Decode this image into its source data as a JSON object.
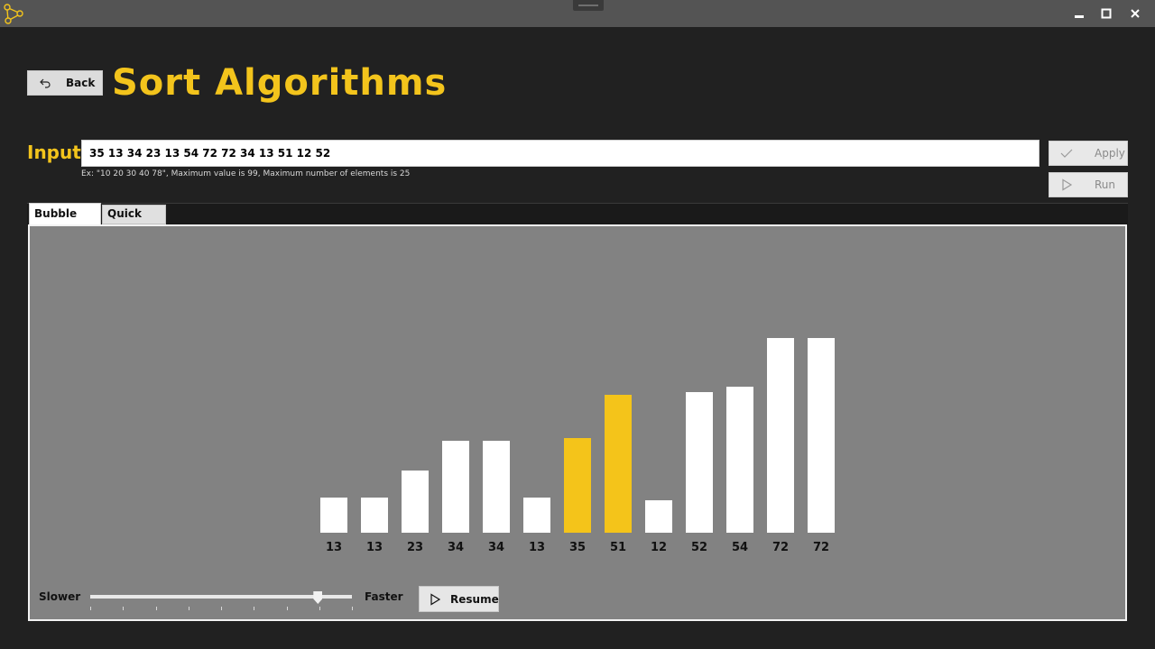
{
  "window": {
    "icons": {
      "app": "molecule-icon",
      "minimize": "minimize-icon",
      "maximize": "maximize-icon",
      "close": "close-icon"
    }
  },
  "header": {
    "back_label": "Back",
    "back_icon": "undo-arrow-icon",
    "title": "Sort Algorithms"
  },
  "input": {
    "label": "Input",
    "value": "35 13 34 23 13 54 72 72 34 13 51 12 52",
    "hint": "Ex: \"10 20 30 40 78\", Maximum value is 99, Maximum number of elements is 25",
    "apply_label": "Apply",
    "apply_icon": "checkmark-icon",
    "run_label": "Run",
    "run_icon": "play-icon"
  },
  "tabs": [
    {
      "label": "Bubble Sort",
      "active": true
    },
    {
      "label": "Quick Sort",
      "active": false
    }
  ],
  "controls": {
    "slower_label": "Slower",
    "faster_label": "Faster",
    "speed_fraction": 0.87,
    "tick_count": 9,
    "resume_label": "Resume",
    "resume_icon": "play-icon"
  },
  "chart_data": {
    "type": "bar",
    "categories": [
      "13",
      "13",
      "23",
      "34",
      "34",
      "13",
      "35",
      "51",
      "12",
      "52",
      "54",
      "72",
      "72"
    ],
    "values": [
      13,
      13,
      23,
      34,
      34,
      13,
      35,
      51,
      12,
      52,
      54,
      72,
      72
    ],
    "highlighted_indices": [
      6,
      7
    ],
    "bar_color": "#ffffff",
    "highlight_color": "#f4c41a",
    "label_color": "#111111",
    "ylim": [
      0,
      72
    ]
  },
  "theme": {
    "accent": "#f3c41c",
    "background": "#212121",
    "panel": "#828282"
  }
}
